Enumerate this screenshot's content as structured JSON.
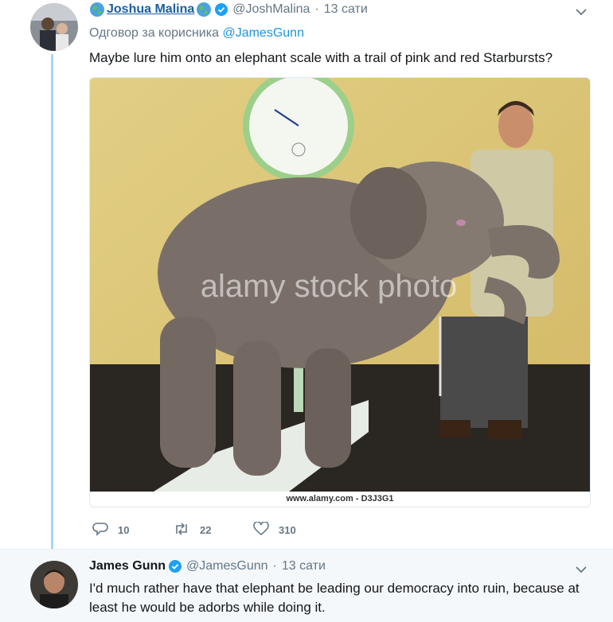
{
  "tweet1": {
    "display_name": "Joshua Malina",
    "handle": "@JoshMalina",
    "separator": "·",
    "time": "13 сати",
    "reply_prefix": "Одговор за корисника",
    "reply_to": "@JamesGunn",
    "text": "Maybe lure him onto an elephant scale with a trail of pink and red Starbursts?",
    "image": {
      "watermark": "alamy stock photo",
      "caption": "www.alamy.com - D3J3G1"
    },
    "actions": {
      "replies": "10",
      "retweets": "22",
      "likes": "310"
    }
  },
  "tweet2": {
    "display_name": "James Gunn",
    "handle": "@JamesGunn",
    "separator": "·",
    "time": "13 сати",
    "text": "I'd much rather have that elephant be leading our democracy into ruin, because at least he would be adorbs while doing it."
  },
  "colors": {
    "link": "#1b95e0",
    "thread": "#a5d6f4",
    "muted": "#657786",
    "verified": "#1da1f2"
  },
  "icons": [
    "globe-icon",
    "verified-icon",
    "chevron-down-icon",
    "reply-icon",
    "retweet-icon",
    "like-icon"
  ]
}
